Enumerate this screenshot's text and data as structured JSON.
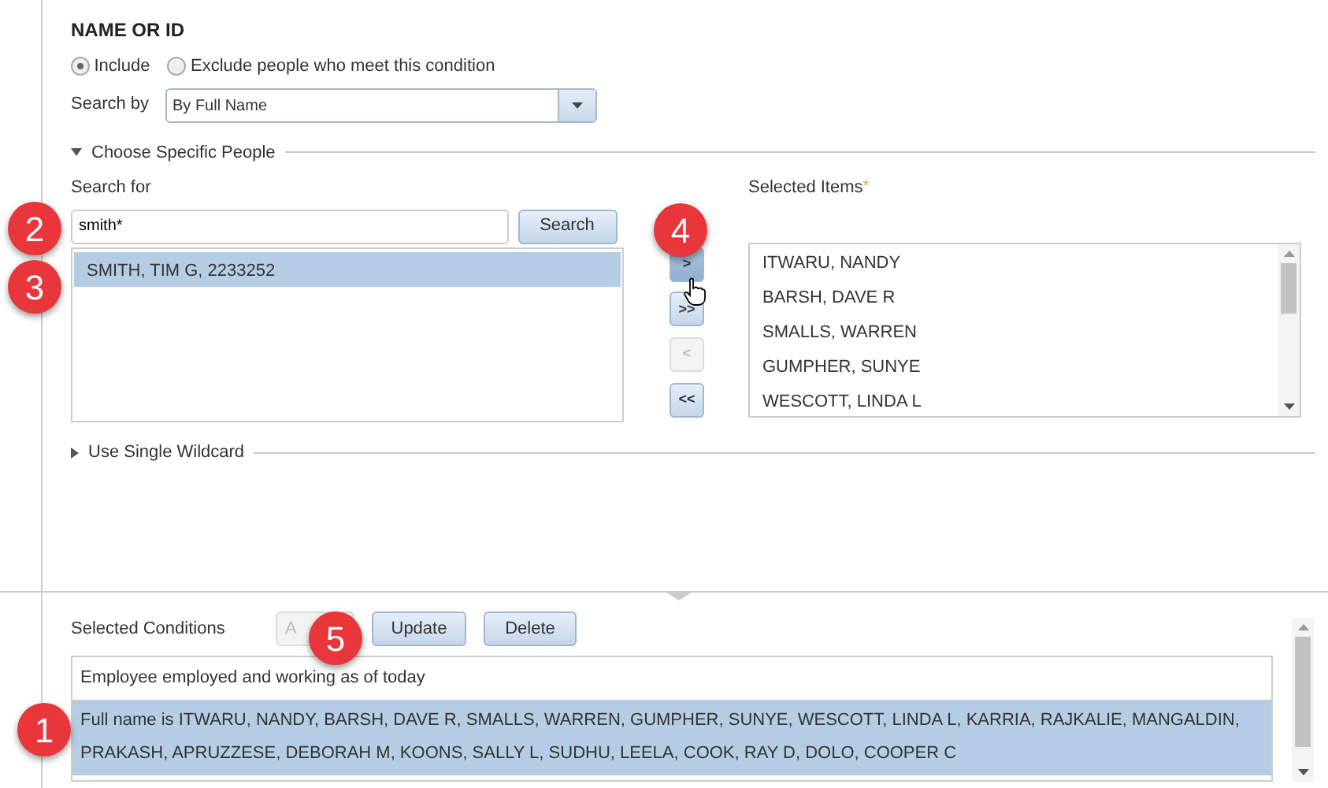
{
  "section_title": "NAME OR ID",
  "mode_options": [
    {
      "label": "Include",
      "selected": true
    },
    {
      "label": "Exclude people who meet this condition",
      "selected": false
    }
  ],
  "search_by": {
    "label": "Search by",
    "value": "By Full Name"
  },
  "choose_group": {
    "label": "Choose Specific People",
    "expanded": true
  },
  "search_for": {
    "label": "Search for",
    "value": "smith*",
    "button": "Search"
  },
  "results": [
    {
      "text": "SMITH, TIM G, 2233252",
      "selected": true
    }
  ],
  "move_buttons": [
    {
      "label": ">",
      "disabled": false,
      "hovered": true
    },
    {
      "label": ">>",
      "disabled": false,
      "hovered": false
    },
    {
      "label": "<",
      "disabled": true,
      "hovered": false
    },
    {
      "label": "<<",
      "disabled": false,
      "hovered": false
    }
  ],
  "selected_items": {
    "label": "Selected Items",
    "required_mark": "*",
    "items": [
      "ITWARU, NANDY",
      "BARSH, DAVE R",
      "SMALLS, WARREN",
      "GUMPHER, SUNYE",
      "WESCOTT, LINDA L"
    ]
  },
  "wildcard_group": {
    "label": "Use Single Wildcard",
    "expanded": false
  },
  "conditions": {
    "label": "Selected Conditions",
    "buttons": [
      {
        "label": "A",
        "disabled": true
      },
      {
        "label": "Update",
        "disabled": false
      },
      {
        "label": "Delete",
        "disabled": false
      }
    ],
    "rows": [
      {
        "text": "Employee employed and working as of today",
        "selected": false
      },
      {
        "text": "Full name is ITWARU, NANDY, BARSH, DAVE R, SMALLS, WARREN, GUMPHER, SUNYE, WESCOTT, LINDA L, KARRIA, RAJKALIE, MANGALDIN, PRAKASH, APRUZZESE, DEBORAH M, KOONS, SALLY L, SUDHU, LEELA, COOK, RAY D, DOLO, COOPER C",
        "selected": true
      }
    ]
  },
  "callouts": [
    {
      "number": "1"
    },
    {
      "number": "2"
    },
    {
      "number": "3"
    },
    {
      "number": "4"
    },
    {
      "number": "5"
    }
  ]
}
